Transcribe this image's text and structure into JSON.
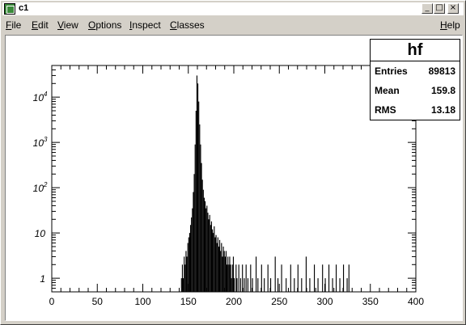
{
  "window": {
    "title": "c1",
    "buttons": {
      "minimize": "_",
      "maximize": "□",
      "close": "×"
    }
  },
  "menu": {
    "items": [
      "File",
      "Edit",
      "View",
      "Options",
      "Inspect",
      "Classes"
    ],
    "help": "Help"
  },
  "stats": {
    "title": "hf",
    "rows": [
      {
        "label": "Entries",
        "value": "89813"
      },
      {
        "label": "Mean",
        "value": "159.8"
      },
      {
        "label": "RMS",
        "value": "13.18"
      }
    ]
  },
  "chart_data": {
    "type": "bar",
    "title": "",
    "xlabel": "",
    "ylabel": "",
    "xlim": [
      0,
      400
    ],
    "ylim": [
      0.5,
      50000
    ],
    "yscale": "log",
    "grid": false,
    "x_ticks": [
      "0",
      "50",
      "100",
      "150",
      "200",
      "250",
      "300",
      "350",
      "400"
    ],
    "y_ticks": [
      "1",
      "10",
      "10^2",
      "10^3",
      "10^4"
    ],
    "bin_width": 1,
    "bins": [
      [
        142,
        1
      ],
      [
        143,
        2
      ],
      [
        144,
        1
      ],
      [
        145,
        3
      ],
      [
        146,
        2
      ],
      [
        147,
        4
      ],
      [
        148,
        3
      ],
      [
        149,
        6
      ],
      [
        150,
        8
      ],
      [
        151,
        10
      ],
      [
        152,
        15
      ],
      [
        153,
        22
      ],
      [
        154,
        35
      ],
      [
        155,
        80
      ],
      [
        156,
        200
      ],
      [
        157,
        900
      ],
      [
        158,
        5000
      ],
      [
        159,
        30000
      ],
      [
        160,
        20000
      ],
      [
        161,
        8000
      ],
      [
        162,
        2500
      ],
      [
        163,
        900
      ],
      [
        164,
        350
      ],
      [
        165,
        150
      ],
      [
        166,
        90
      ],
      [
        167,
        60
      ],
      [
        168,
        50
      ],
      [
        169,
        35
      ],
      [
        170,
        40
      ],
      [
        171,
        28
      ],
      [
        172,
        20
      ],
      [
        173,
        25
      ],
      [
        174,
        15
      ],
      [
        175,
        18
      ],
      [
        176,
        12
      ],
      [
        177,
        10
      ],
      [
        178,
        14
      ],
      [
        179,
        8
      ],
      [
        180,
        9
      ],
      [
        181,
        6
      ],
      [
        182,
        8
      ],
      [
        183,
        5
      ],
      [
        184,
        7
      ],
      [
        185,
        4
      ],
      [
        186,
        6
      ],
      [
        187,
        3
      ],
      [
        188,
        5
      ],
      [
        189,
        4
      ],
      [
        190,
        3
      ],
      [
        191,
        4
      ],
      [
        192,
        2
      ],
      [
        193,
        3
      ],
      [
        194,
        2
      ],
      [
        195,
        3
      ],
      [
        196,
        2
      ],
      [
        197,
        1
      ],
      [
        198,
        2
      ],
      [
        199,
        3
      ],
      [
        200,
        1
      ],
      [
        202,
        2
      ],
      [
        203,
        1
      ],
      [
        205,
        2
      ],
      [
        207,
        1
      ],
      [
        209,
        2
      ],
      [
        211,
        1
      ],
      [
        213,
        2
      ],
      [
        215,
        1
      ],
      [
        218,
        2
      ],
      [
        220,
        1
      ],
      [
        224,
        3
      ],
      [
        226,
        1
      ],
      [
        230,
        2
      ],
      [
        233,
        1
      ],
      [
        237,
        2
      ],
      [
        240,
        1
      ],
      [
        245,
        3
      ],
      [
        248,
        1
      ],
      [
        252,
        2
      ],
      [
        257,
        1
      ],
      [
        262,
        2
      ],
      [
        266,
        1
      ],
      [
        270,
        2
      ],
      [
        274,
        1
      ],
      [
        279,
        3
      ],
      [
        283,
        1
      ],
      [
        288,
        2
      ],
      [
        292,
        1
      ],
      [
        297,
        2
      ],
      [
        300,
        1
      ],
      [
        304,
        2
      ],
      [
        308,
        1
      ],
      [
        312,
        2
      ],
      [
        316,
        1
      ],
      [
        320,
        2
      ],
      [
        324,
        1
      ],
      [
        326,
        2
      ]
    ]
  }
}
